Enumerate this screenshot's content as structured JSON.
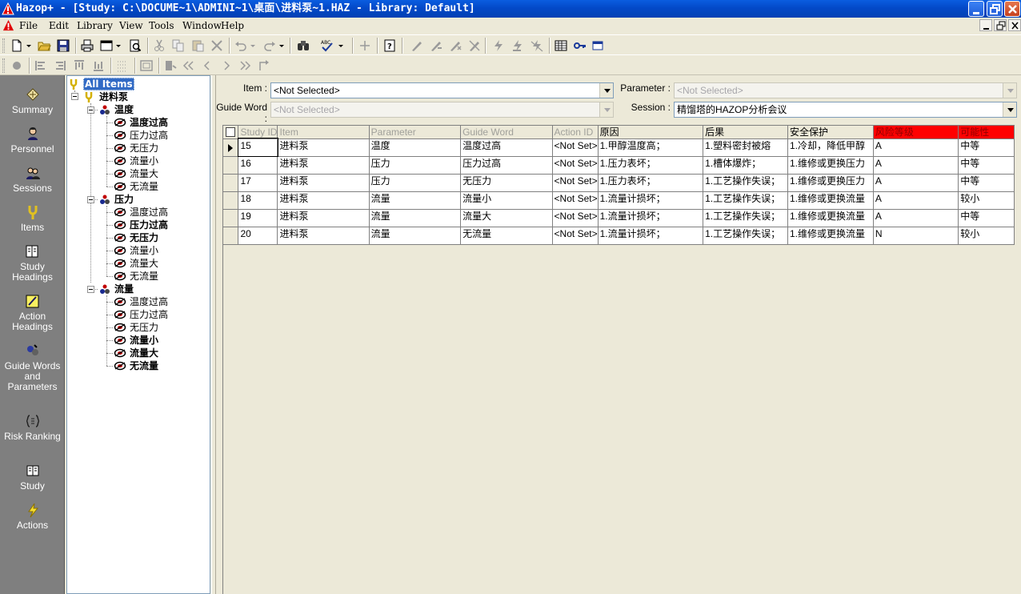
{
  "window": {
    "title": "Hazop+ - [Study: C:\\DOCUME~1\\ADMINI~1\\桌面\\进料泵~1.HAZ - Library: Default]"
  },
  "menu": {
    "items": [
      "File",
      "Edit",
      "Library",
      "View",
      "Tools",
      "Window",
      "Help"
    ]
  },
  "sidebar": {
    "items": [
      {
        "label": "Summary",
        "icon": "summary-icon"
      },
      {
        "label": "Personnel",
        "icon": "personnel-icon"
      },
      {
        "label": "Sessions",
        "icon": "sessions-icon"
      },
      {
        "label": "Items",
        "icon": "items-icon"
      },
      {
        "label": "Study Headings",
        "icon": "study-headings-icon"
      },
      {
        "label": "Action Headings",
        "icon": "action-headings-icon"
      },
      {
        "label": "Guide Words and Parameters",
        "icon": "guide-words-icon"
      },
      {
        "label": "Risk Ranking",
        "icon": "risk-ranking-icon"
      },
      {
        "label": "Study",
        "icon": "study-icon"
      },
      {
        "label": "Actions",
        "icon": "actions-icon"
      }
    ]
  },
  "tree": {
    "root": "All Items",
    "item": "进料泵",
    "groups": [
      {
        "name": "温度",
        "children": [
          "温度过高",
          "压力过高",
          "无压力",
          "流量小",
          "流量大",
          "无流量"
        ],
        "bold": [
          true,
          false,
          false,
          false,
          false,
          false
        ]
      },
      {
        "name": "压力",
        "children": [
          "温度过高",
          "压力过高",
          "无压力",
          "流量小",
          "流量大",
          "无流量"
        ],
        "bold": [
          false,
          true,
          true,
          false,
          false,
          false
        ]
      },
      {
        "name": "流量",
        "children": [
          "温度过高",
          "压力过高",
          "无压力",
          "流量小",
          "流量大",
          "无流量"
        ],
        "bold": [
          false,
          false,
          false,
          true,
          true,
          true
        ]
      }
    ]
  },
  "filters": {
    "item_label": "Item :",
    "item_value": "<Not Selected>",
    "guide_word_label": "Guide Word :",
    "guide_word_value": "<Not Selected>",
    "parameter_label": "Parameter :",
    "parameter_value": "<Not Selected>",
    "session_label": "Session :",
    "session_value": "精馏塔的HAZOP分析会议"
  },
  "grid": {
    "columns": [
      "Study ID",
      "Item",
      "Parameter",
      "Guide Word",
      "Action ID",
      "原因",
      "后果",
      "安全保护",
      "风险等级",
      "可能性"
    ],
    "dim_columns": [
      true,
      true,
      true,
      true,
      true,
      false,
      false,
      false,
      false,
      false
    ],
    "red_columns": [
      false,
      false,
      false,
      false,
      false,
      false,
      false,
      false,
      true,
      true
    ],
    "rows": [
      [
        "15",
        "进料泵",
        "温度",
        "温度过高",
        "<Not Set>",
        "1.甲醇温度高；",
        "1.塑料密封被熔",
        "1.冷却，降低甲醇",
        "A",
        "中等"
      ],
      [
        "16",
        "进料泵",
        "压力",
        "压力过高",
        "<Not Set>",
        "1.压力表坏；",
        "1.槽体爆炸；",
        "1.维修或更换压力",
        "A",
        "中等"
      ],
      [
        "17",
        "进料泵",
        "压力",
        "无压力",
        "<Not Set>",
        "1.压力表坏；",
        "1.工艺操作失误；",
        "1.维修或更换压力",
        "A",
        "中等"
      ],
      [
        "18",
        "进料泵",
        "流量",
        "流量小",
        "<Not Set>",
        "1.流量计损坏；",
        "1.工艺操作失误；",
        "1.维修或更换流量",
        "A",
        "较小"
      ],
      [
        "19",
        "进料泵",
        "流量",
        "流量大",
        "<Not Set>",
        "1.流量计损坏；",
        "1.工艺操作失误；",
        "1.维修或更换流量",
        "A",
        "中等"
      ],
      [
        "20",
        "进料泵",
        "流量",
        "无流量",
        "<Not Set>",
        "1.流量计损坏；",
        "1.工艺操作失误；",
        "1.维修或更换流量",
        "N",
        "较小"
      ]
    ],
    "current_row": 0
  },
  "colors": {
    "title_bar": "#0349c8",
    "sidebar_bg": "#7f7f7f",
    "risk_header": "#ff0000",
    "selection": "#316ac5"
  }
}
